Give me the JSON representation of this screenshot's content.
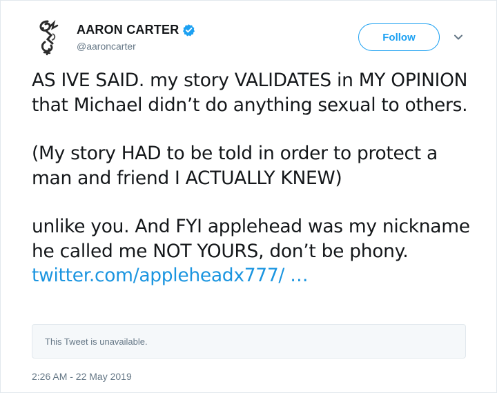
{
  "colors": {
    "accent": "#1da1f2",
    "link": "#1b95e0",
    "text": "#14171a",
    "muted": "#657786",
    "border": "#e1e8ed",
    "card_bg": "#f5f8fa"
  },
  "author": {
    "display_name": "AARON CARTER",
    "handle": "@aaroncarter",
    "verified_icon": "verified-badge-icon",
    "avatar_icon": "avatar-logo"
  },
  "header": {
    "follow_label": "Follow",
    "menu_icon": "chevron-down-icon"
  },
  "tweet": {
    "paragraph_1": "AS IVE SAID. my story VALIDATES in MY OPINION that Michael didn’t do anything sexual to others.",
    "paragraph_2": "(My story HAD to be told in order to protect a man and friend I ACTUALLY KNEW)",
    "paragraph_3": "unlike you. And FYI applehead was my nickname he called me NOT YOURS, don’t be phony.",
    "link_text": "twitter.com/appleheadx777/ …"
  },
  "quote_card": {
    "text": "This Tweet is unavailable."
  },
  "footer": {
    "timestamp": "2:26 AM - 22 May 2019"
  }
}
